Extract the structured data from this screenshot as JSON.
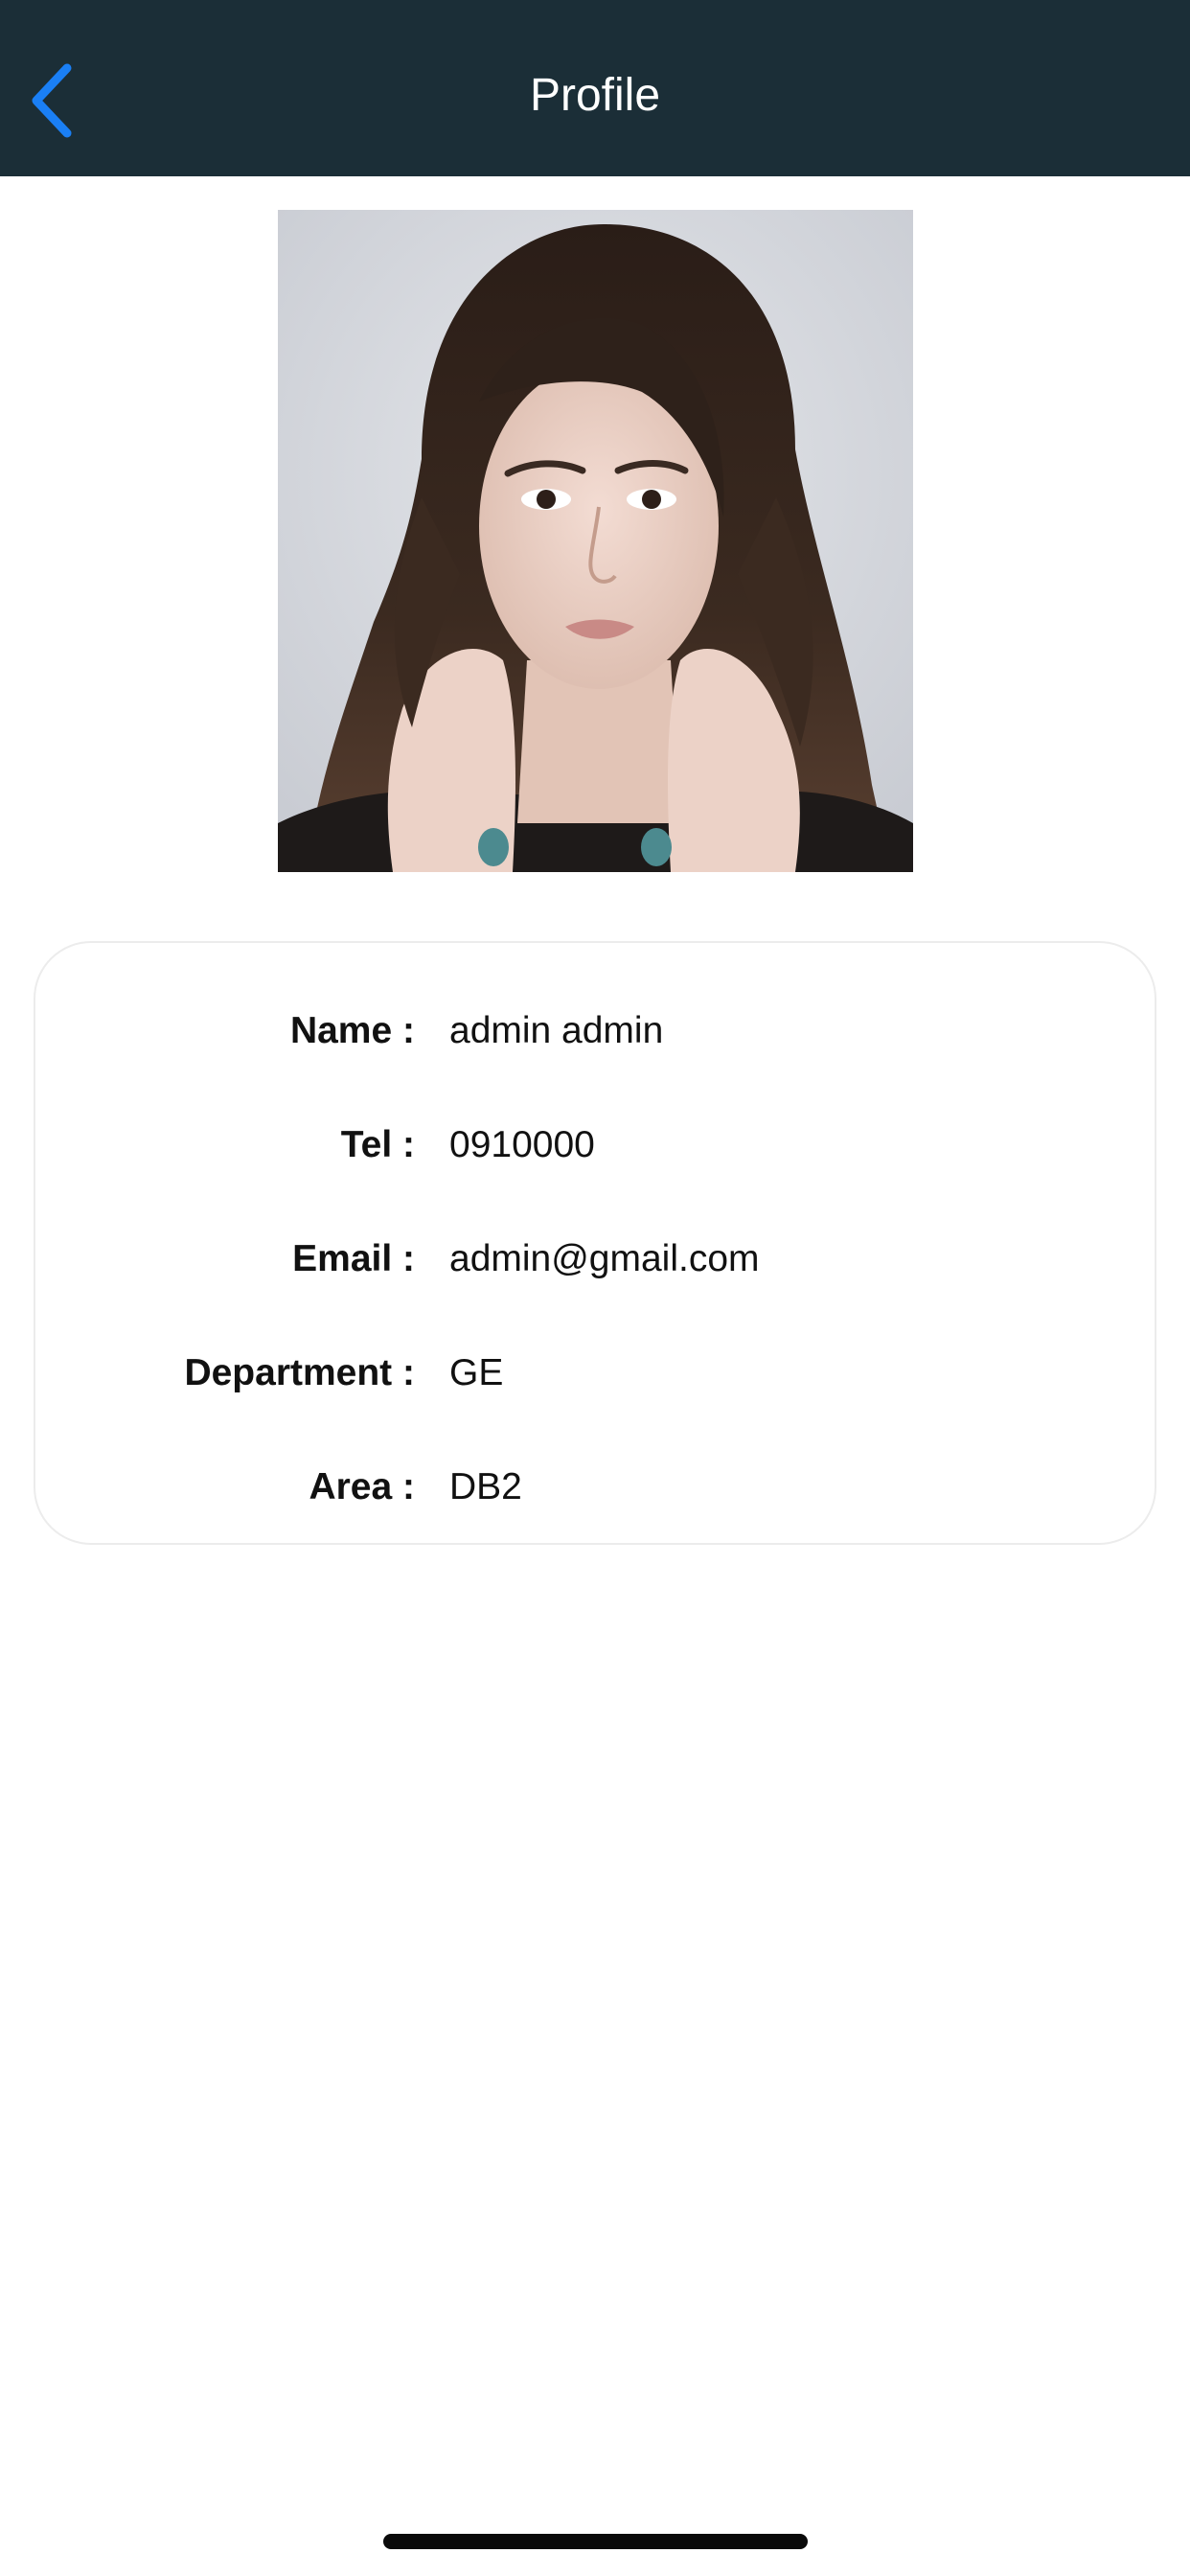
{
  "navbar": {
    "title": "Profile",
    "back_icon": "chevron-left-icon",
    "colors": {
      "background": "#1b2e37",
      "title": "#ffffff",
      "back_icon": "#1a7ff5"
    }
  },
  "profile_photo": {
    "icon": "portrait-photo"
  },
  "details": {
    "rows": [
      {
        "label": "Name :",
        "value": "admin admin"
      },
      {
        "label": "Tel :",
        "value": "0910000"
      },
      {
        "label": "Email :",
        "value": "admin@gmail.com"
      },
      {
        "label": "Department :",
        "value": "GE"
      },
      {
        "label": "Area :",
        "value": "DB2"
      }
    ]
  }
}
